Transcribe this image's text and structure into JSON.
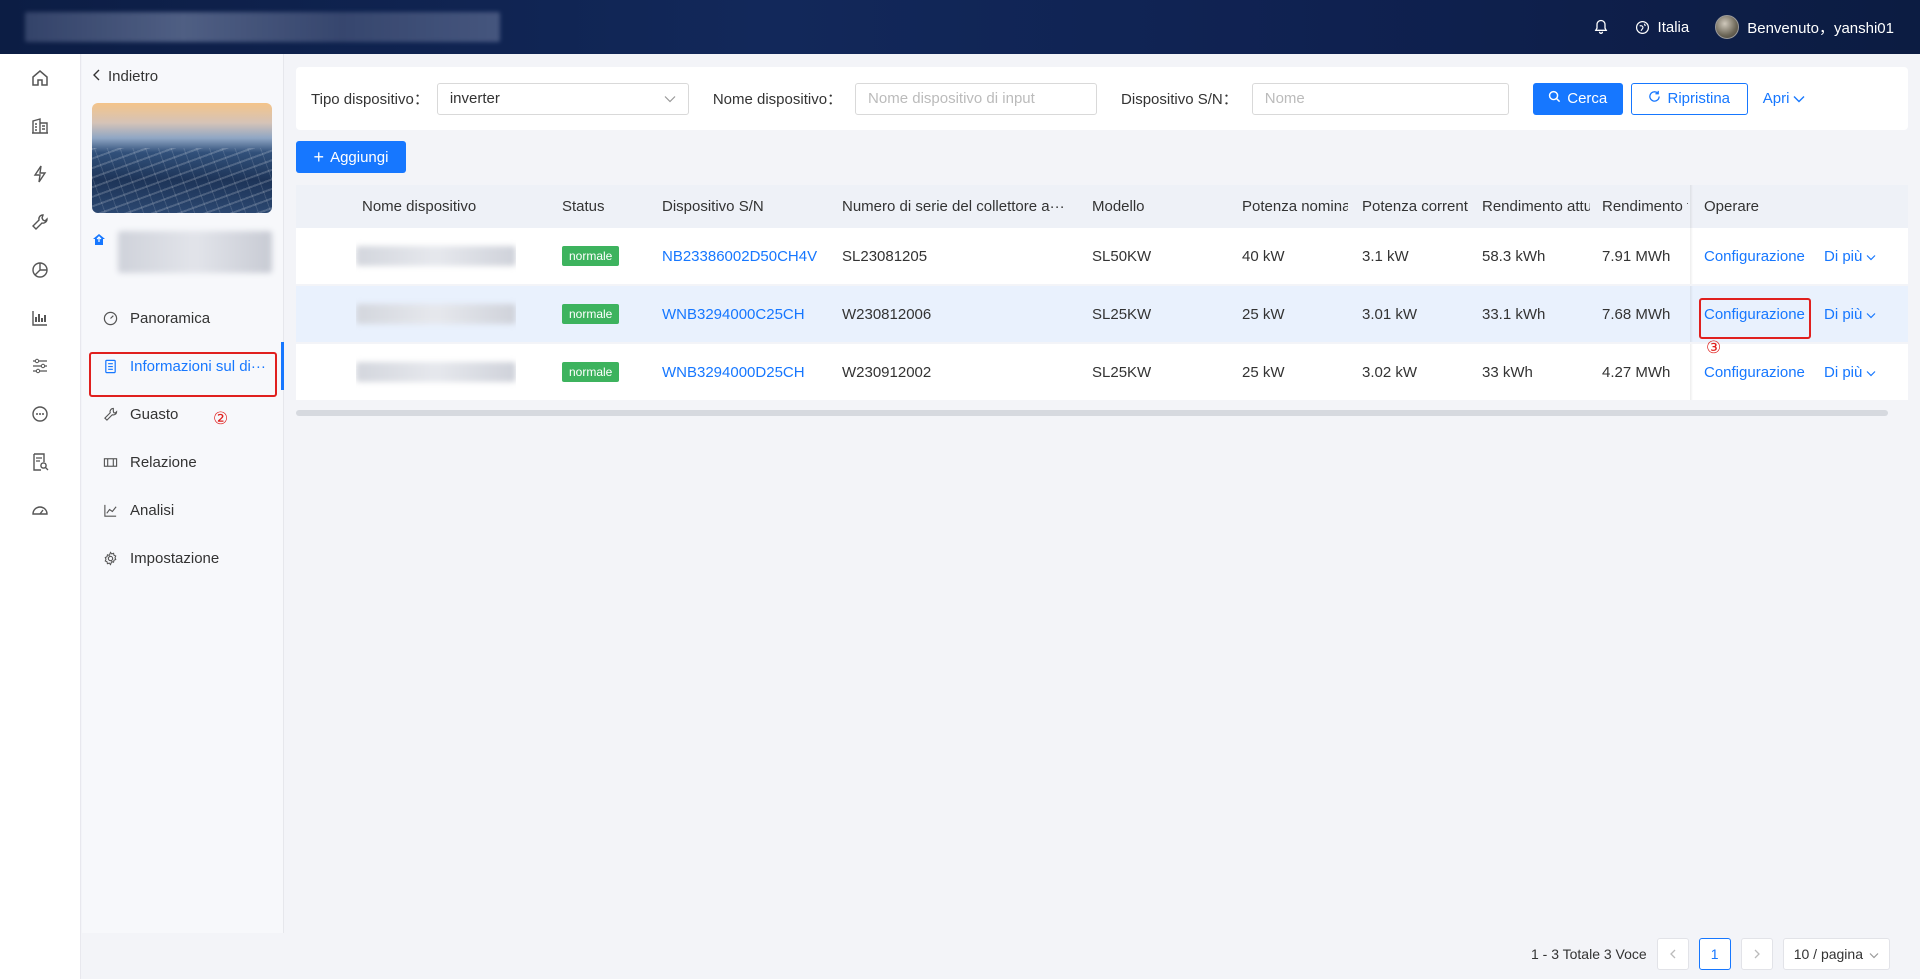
{
  "topbar": {
    "language": "Italia",
    "welcome": "Benvenuto，yanshi01"
  },
  "rail": {
    "icons": [
      "home-icon",
      "building-icon",
      "bolt-icon",
      "wrench-icon",
      "pie-chart-icon",
      "bar-chart-icon",
      "sliders-icon",
      "chat-icon",
      "report-search-icon",
      "gauge-icon"
    ]
  },
  "sidebar": {
    "back_label": "Indietro",
    "items": [
      {
        "label": "Panoramica",
        "icon": "dashboard-icon"
      },
      {
        "label": "Informazioni sul di···",
        "icon": "document-icon"
      },
      {
        "label": "Guasto",
        "icon": "wrench-icon"
      },
      {
        "label": "Relazione",
        "icon": "report-icon"
      },
      {
        "label": "Analisi",
        "icon": "line-chart-icon"
      },
      {
        "label": "Impostazione",
        "icon": "gear-icon"
      }
    ],
    "active_index": 1
  },
  "filter": {
    "type_label": "Tipo dispositivo：",
    "type_value": "inverter",
    "name_label": "Nome dispositivo：",
    "name_placeholder": "Nome dispositivo di input",
    "sn_label": "Dispositivo S/N：",
    "sn_placeholder": "Nome",
    "search_label": "Cerca",
    "reset_label": "Ripristina",
    "expand_label": "Apri"
  },
  "add_label": "Aggiungi",
  "table": {
    "headers": [
      "Nome dispositivo",
      "Status",
      "Dispositivo S/N",
      "Numero di serie del collettore a···",
      "Modello",
      "Potenza nominale",
      "Potenza corrent",
      "Rendimento attu",
      "Rendimento t",
      "Operare"
    ],
    "rows": [
      {
        "status": "normale",
        "sn": "NB23386002D50CH4V",
        "collector": "SL23081205",
        "model": "SL50KW",
        "rated": "40 kW",
        "current": "3.1 kW",
        "yield_today": "58.3 kWh",
        "yield_total": "7.91 MWh",
        "config": "Configurazione",
        "more": "Di più"
      },
      {
        "status": "normale",
        "sn": "WNB3294000C25CH",
        "collector": "W230812006",
        "model": "SL25KW",
        "rated": "25 kW",
        "current": "3.01 kW",
        "yield_today": "33.1 kWh",
        "yield_total": "7.68 MWh",
        "config": "Configurazione",
        "more": "Di più"
      },
      {
        "status": "normale",
        "sn": "WNB3294000D25CH",
        "collector": "W230912002",
        "model": "SL25KW",
        "rated": "25 kW",
        "current": "3.02 kW",
        "yield_today": "33 kWh",
        "yield_total": "4.27 MWh",
        "config": "Configurazione",
        "more": "Di più"
      }
    ]
  },
  "annotations": {
    "step2": "②",
    "step3": "③"
  },
  "pager": {
    "summary": "1 - 3 Totale 3 Voce",
    "current_page": "1",
    "page_size": "10 / pagina"
  },
  "colors": {
    "accent": "#1677ff",
    "status_normal": "#3db35e",
    "highlight": "#e0201e"
  }
}
